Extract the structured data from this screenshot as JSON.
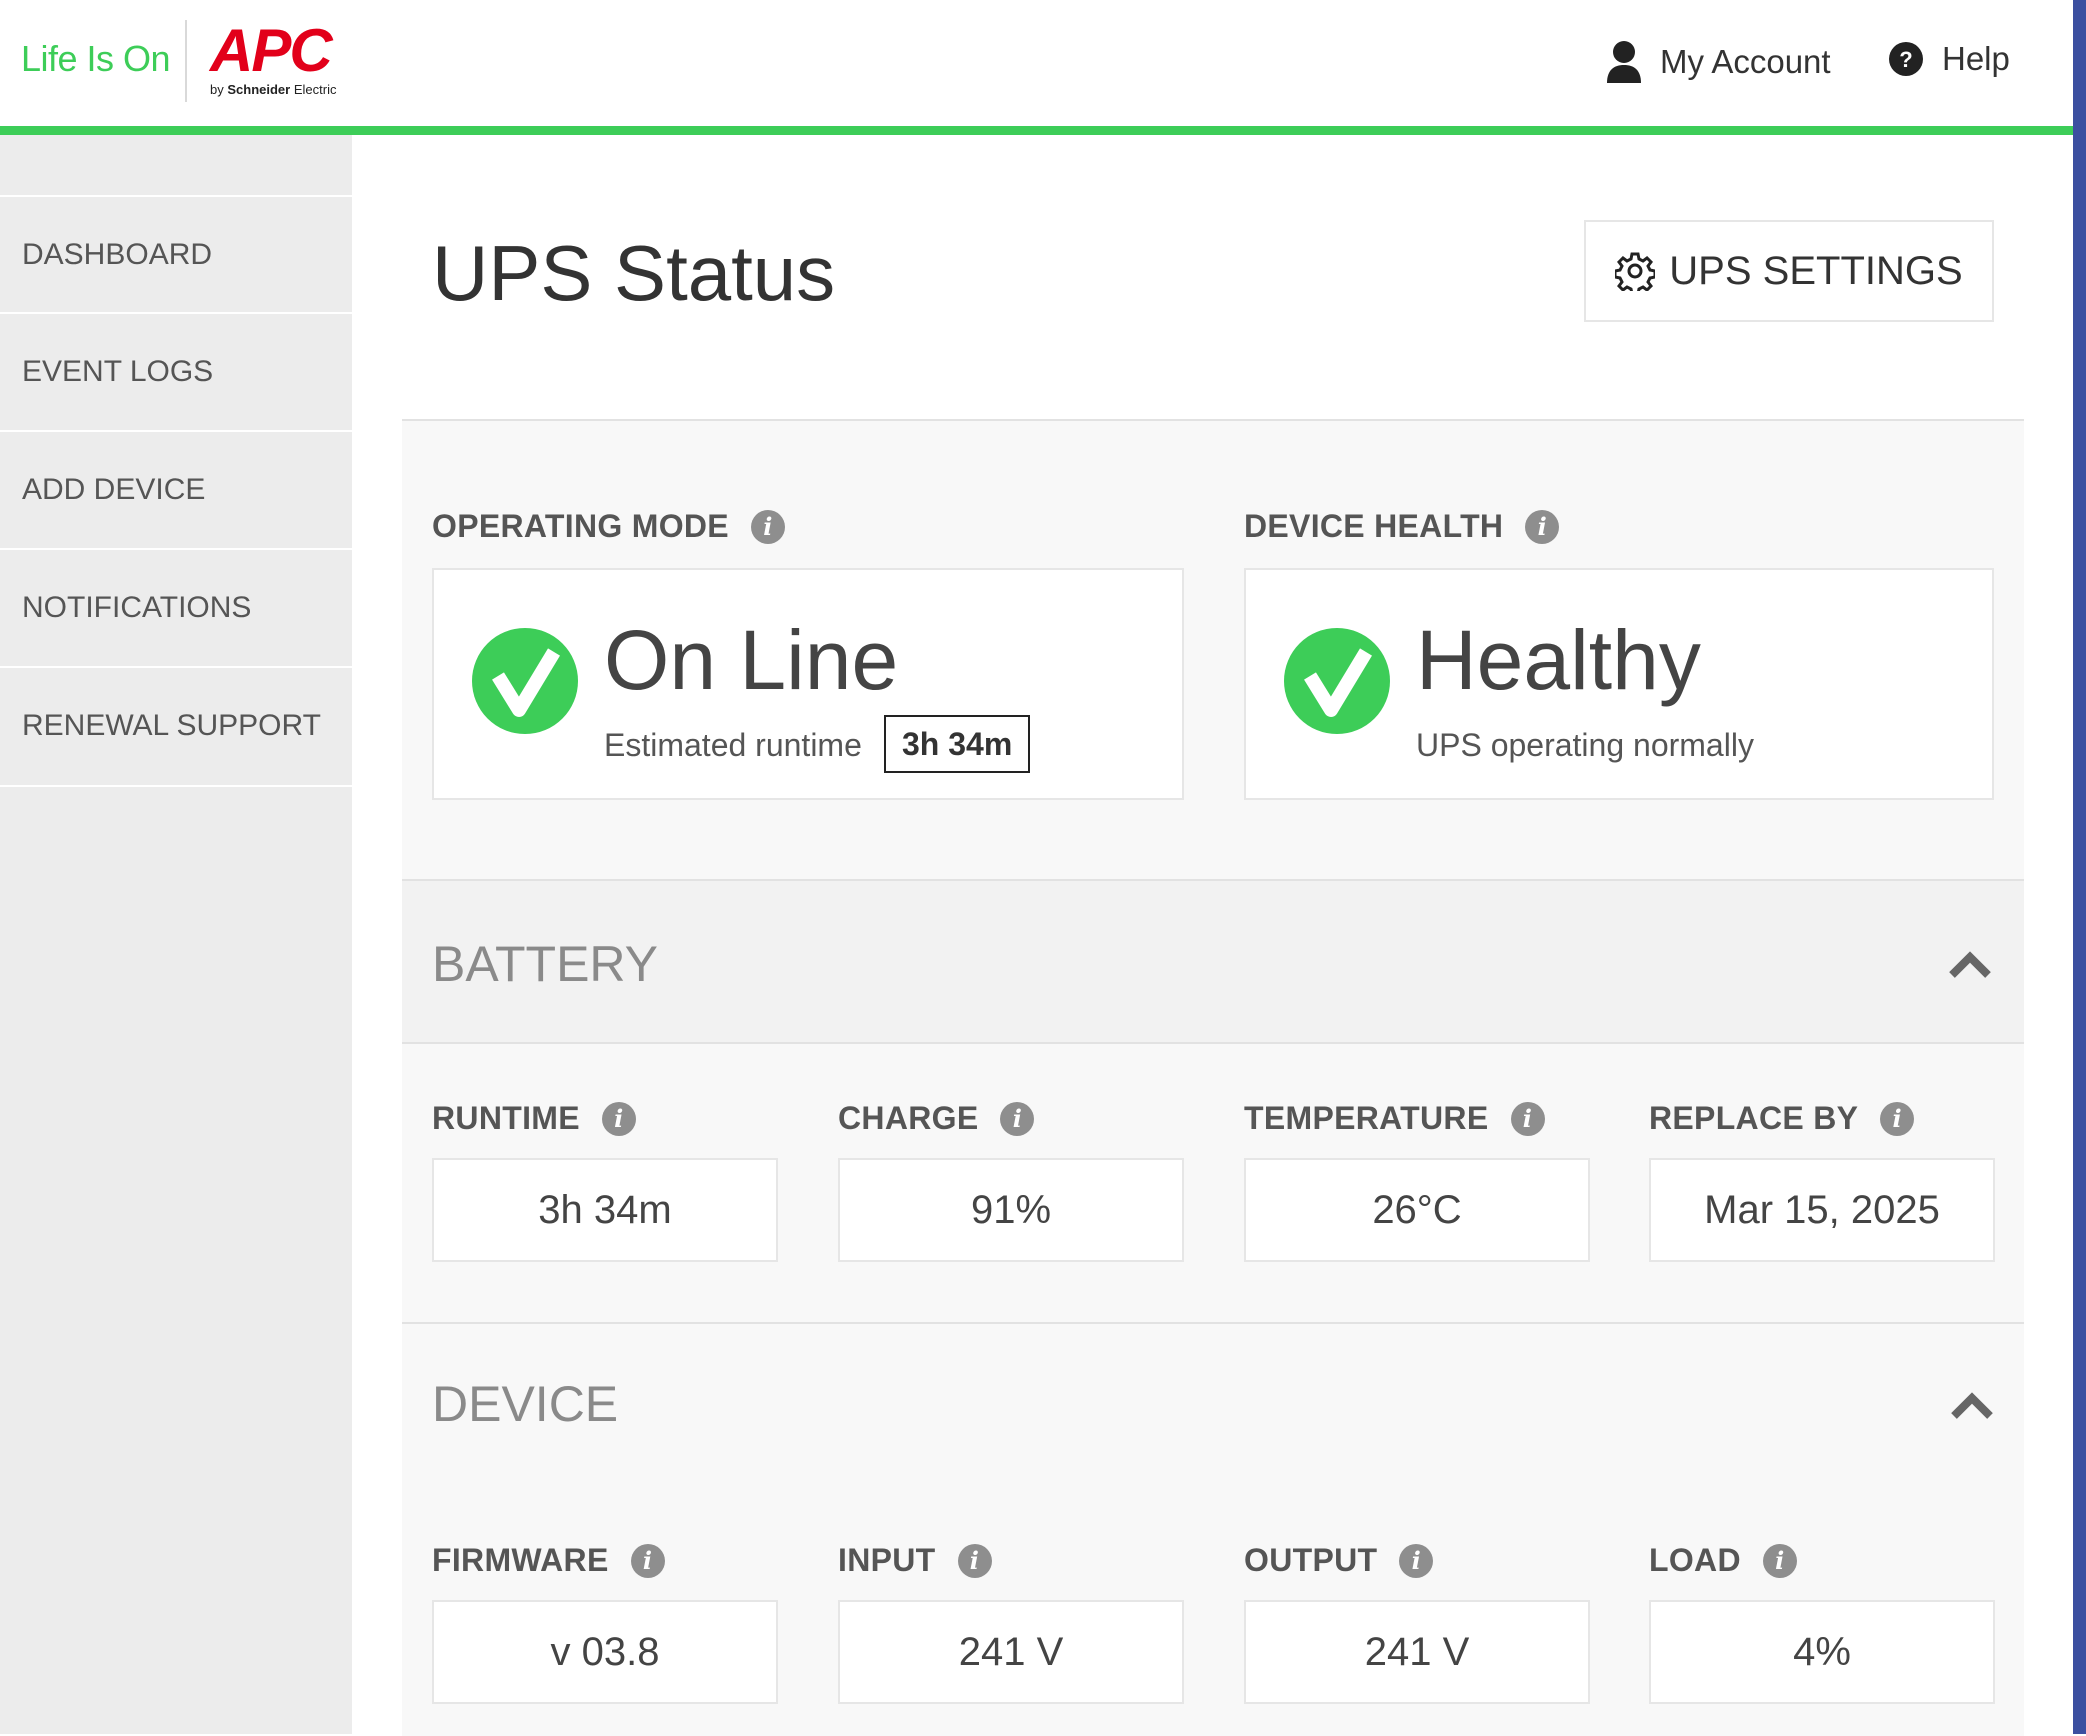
{
  "header": {
    "tagline": "Life Is On",
    "brand": "APC",
    "brand_sub_prefix": "by",
    "brand_sub_company": "Schneider",
    "brand_sub_suffix": "Electric",
    "account_label": "My Account",
    "help_label": "Help",
    "accent_color": "#3dcd58"
  },
  "sidebar": {
    "items": [
      {
        "label": "DASHBOARD"
      },
      {
        "label": "EVENT LOGS"
      },
      {
        "label": "ADD DEVICE"
      },
      {
        "label": "NOTIFICATIONS"
      },
      {
        "label": "RENEWAL SUPPORT"
      }
    ]
  },
  "main": {
    "title": "UPS Status",
    "settings_label": "UPS SETTINGS",
    "operating_mode": {
      "label": "OPERATING MODE",
      "value": "On Line",
      "sub_label": "Estimated runtime",
      "runtime": "3h 34m"
    },
    "device_health": {
      "label": "DEVICE HEALTH",
      "value": "Healthy",
      "sub_label": "UPS operating normally"
    },
    "battery": {
      "title": "BATTERY",
      "fields": [
        {
          "label": "RUNTIME",
          "value": "3h 34m"
        },
        {
          "label": "CHARGE",
          "value": "91%"
        },
        {
          "label": "TEMPERATURE",
          "value": "26°C"
        },
        {
          "label": "REPLACE BY",
          "value": "Mar 15, 2025"
        }
      ]
    },
    "device": {
      "title": "DEVICE",
      "fields": [
        {
          "label": "FIRMWARE",
          "value": "v 03.8"
        },
        {
          "label": "INPUT",
          "value": "241 V"
        },
        {
          "label": "OUTPUT",
          "value": "241 V"
        },
        {
          "label": "LOAD",
          "value": "4%"
        }
      ]
    }
  },
  "icons": {
    "account": "user-icon",
    "help": "help-circle-icon",
    "settings": "gear-icon",
    "status_ok": "check-circle-icon",
    "info": "info-icon",
    "collapse": "chevron-up-icon"
  }
}
